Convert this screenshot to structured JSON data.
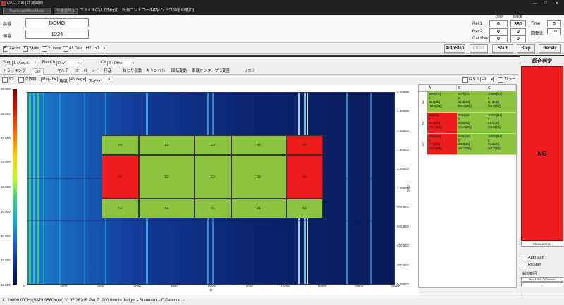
{
  "window": {
    "title": "ON-1200 [計測画面]"
  },
  "menubar": {
    "mode_tab": "TrackingOfflineMode",
    "machine_tab": "号機番号:1",
    "items": [
      "ファイル(F)",
      "入力設定(I)",
      "計測コントロール(C)",
      "ウィンドウ(W)",
      "その他(O)"
    ]
  },
  "header": {
    "product_label": "品番",
    "product_value": "DEMO",
    "serial_label": "個番",
    "serial_value": "1234",
    "rmin_header": "r/min",
    "block_header": "Block",
    "rev1_label": "Rev1",
    "rev1_value": "0",
    "block1_value": "361",
    "rev2_label": "Rev2",
    "rev2_value": "0",
    "block2_value": "0",
    "calcrev_label": "CalcRev",
    "calcrev_value": "0",
    "block3_value": "0",
    "time_label": "Time",
    "time_value": "0",
    "ratio_label": "回転比",
    "ratio_value": "1.000"
  },
  "toolbar": {
    "xauto": "XAuto",
    "yauto": "YAuto",
    "ylinear": "YLinear",
    "alldata": "All Data",
    "hz": "Hz",
    "xsel": "x1",
    "autostep": "AutoStep",
    "check": "Check",
    "start": "Start",
    "step": "Step",
    "recalc": "Recalc"
  },
  "chanbar": {
    "step_label": "Step",
    "step_value": "1 : Acc.①",
    "revch_label": "RevCh",
    "revch_value": "Rev1",
    "ch_label": "Ch",
    "ch_value": "8 : Other"
  },
  "tabs": [
    "トラッキング",
    "3D",
    "マルチ",
    "オーバーレイ",
    "打音",
    "ねじり振動",
    "キャンベル",
    "回転変動",
    "車載オシタープ",
    "2変量",
    "リスト"
  ],
  "opts": {
    "threed": "3D",
    "order_line": "次数線",
    "map_sel": "Map-Jv",
    "angle_label": "角度",
    "angle_value": "45 deg",
    "skip_label": "スキップ",
    "skip_value": "1",
    "gsj": "G.S.J",
    "fill_sel": "Fill",
    "color": "カラー"
  },
  "colorbar": {
    "ticks": [
      "90.000",
      "80.000",
      "70.000",
      "60.000",
      "50.000",
      "40.000",
      "30.000",
      "20.000",
      "10.000"
    ]
  },
  "xaxis": {
    "ticks": [
      "0",
      "2000",
      "4000",
      "6000",
      "8000",
      "10000",
      "12000",
      "14000",
      "16000",
      "18000",
      "20000"
    ],
    "label": "Hz"
  },
  "raxis": {
    "ticks": [
      "2.000E3",
      "1.800E3",
      "1.600E3",
      "1.400E3",
      "1.200E3",
      "1.000E3",
      "800.0E2",
      "600.0E2",
      "400.0E2",
      "200.0E2",
      "0.000E0"
    ],
    "label": "r/min"
  },
  "grid": {
    "rows": [
      [
        {
          "t": "A0",
          "c": "g"
        },
        {
          "t": "B0",
          "c": "g"
        },
        {
          "t": "C0",
          "c": "g"
        },
        {
          "t": "D0",
          "c": "g"
        },
        {
          "t": "E0",
          "c": "r"
        }
      ],
      [
        {
          "t": "A2",
          "c": "r"
        },
        {
          "t": "B2",
          "c": "g"
        },
        {
          "t": "C2",
          "c": "g"
        },
        {
          "t": "D2",
          "c": "g"
        },
        {
          "t": "E2",
          "c": "r"
        }
      ],
      [
        {
          "t": "A1",
          "c": "g"
        },
        {
          "t": "B1",
          "c": "g"
        },
        {
          "t": "C1",
          "c": "g"
        },
        {
          "t": "D1",
          "c": "g"
        },
        {
          "t": "E1",
          "c": "g"
        }
      ]
    ]
  },
  "result_table": {
    "columns": [
      "A",
      "B",
      "C"
    ],
    "rows": [
      {
        "idx": "3",
        "cells": [
          {
            "c": "g",
            "lines": [
              "4075[Hz]",
              "0",
              "50.0[dB]",
              "(70.0[dB])"
            ]
          },
          {
            "c": "g",
            "lines": [
              "6075[Hz]",
              "0",
              "51.6[dB]",
              "(60.0[dB])"
            ]
          },
          {
            "c": "g",
            "lines": [
              "10000[Hz]",
              "0",
              "50.0[dB]",
              "(55.0[dB])"
            ]
          }
        ]
      },
      {
        "idx": "2",
        "cells": [
          {
            "c": "r",
            "lines": [
              "200[Hz]",
              "0",
              "51.0[dB]",
              "(75.0[dB])"
            ]
          },
          {
            "c": "g",
            "lines": [
              "5025[Hz]",
              "0",
              "53.2[dB]",
              "(60.0[dB])"
            ]
          },
          {
            "c": "g",
            "lines": [
              "10000[Hz]",
              "0",
              "51.6[dB]",
              "(55.0[dB])"
            ]
          }
        ]
      },
      {
        "idx": "1",
        "cells": [
          {
            "c": "r",
            "lines": [
              "3700[Hz]",
              "0",
              "57.0[dB]",
              "(70.0[dB])"
            ]
          },
          {
            "c": "g",
            "lines": [
              "6200[Hz]",
              "0",
              "43.4[dB]",
              "(60.0[dB])"
            ]
          },
          {
            "c": "g",
            "lines": [
              "10000[Hz]",
              "0",
              "50.2[dB]",
              "(55.0[dB])"
            ]
          }
        ]
      }
    ]
  },
  "judgement": {
    "title": "総合判定",
    "result": "NG",
    "footer": "MeasureEnd",
    "autostart": "AutoStart",
    "restart": "ReStart",
    "range_title": "解析範囲",
    "range_value": "Rev:1269~2000r/min",
    "range_blank": "--"
  },
  "status": {
    "text": "X: 20000.000Hz(5879.958Order)  Y: 37.262dB  Par Z: 200.0r/min  Judge: -  Standard: -  Difference: -"
  },
  "colors": {
    "pass": "#8cc43f",
    "fail": "#ee1c1c"
  }
}
